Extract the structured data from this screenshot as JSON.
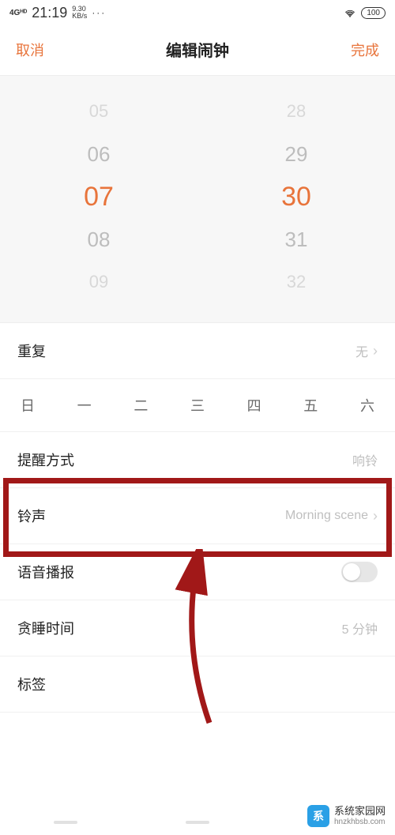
{
  "status": {
    "network": "4Gᴴᴰ",
    "time": "21:19",
    "speed_top": "9.30",
    "speed_bot": "KB/s",
    "dots": "···",
    "battery": "100"
  },
  "header": {
    "cancel": "取消",
    "title": "编辑闹钟",
    "done": "完成"
  },
  "picker": {
    "hours": [
      "05",
      "06",
      "07",
      "08",
      "09"
    ],
    "minutes": [
      "28",
      "29",
      "30",
      "31",
      "32"
    ],
    "selected_hour": "07",
    "selected_minute": "30"
  },
  "rows": {
    "repeat": {
      "label": "重复",
      "value": "无"
    },
    "remind": {
      "label": "提醒方式",
      "value": "响铃"
    },
    "ringtone": {
      "label": "铃声",
      "value": "Morning scene"
    },
    "voice": {
      "label": "语音播报",
      "on": false
    },
    "snooze": {
      "label": "贪睡时间",
      "value": "5 分钟"
    },
    "tag": {
      "label": "标签"
    }
  },
  "weekdays": [
    "日",
    "一",
    "二",
    "三",
    "四",
    "五",
    "六"
  ],
  "watermark": {
    "brand": "系统家园网",
    "url": "hnzkhbsb.com",
    "logo_char": "系"
  }
}
